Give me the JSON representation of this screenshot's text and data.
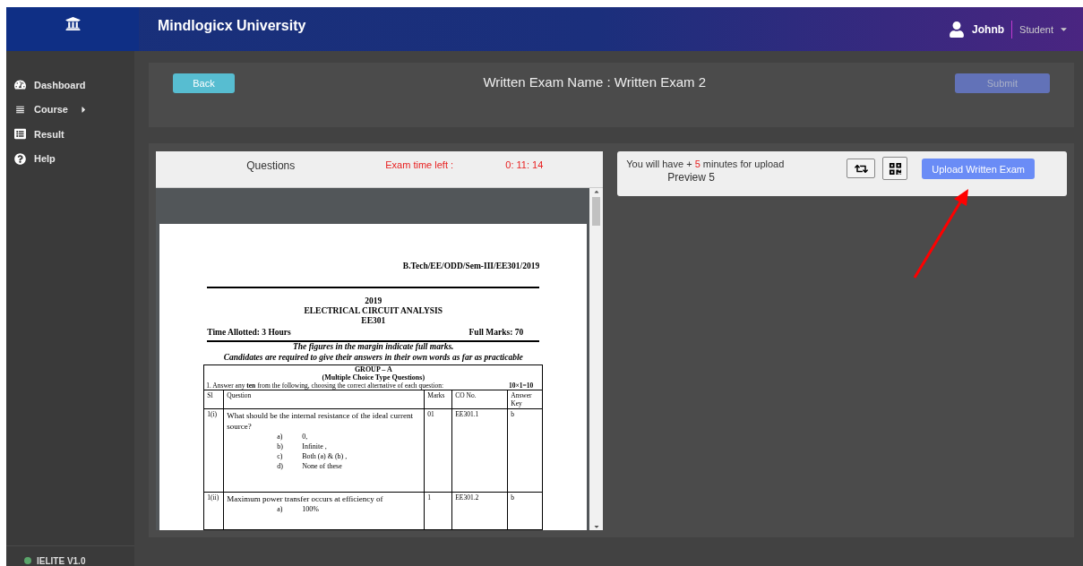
{
  "header": {
    "title": "Mindlogicx University",
    "user": {
      "name": "Johnb",
      "role": "Student"
    }
  },
  "sidebar": {
    "items": [
      {
        "kind": "dashboard",
        "label": "Dashboard",
        "submenu": false
      },
      {
        "kind": "course",
        "label": "Course",
        "submenu": true
      },
      {
        "kind": "result",
        "label": "Result",
        "submenu": false
      },
      {
        "kind": "help",
        "label": "Help",
        "submenu": false
      }
    ],
    "version": "IELITE V1.0"
  },
  "exam_bar": {
    "back": "Back",
    "title": "Written Exam Name : Written Exam 2",
    "submit": {
      "label": "Submit",
      "disabled": true
    }
  },
  "questions_panel": {
    "title": "Questions",
    "timer_label": "Exam time left :",
    "timer_value": "0: 11: 14"
  },
  "document": {
    "ref": "B.Tech/EE/ODD/Sem-III/EE301/2019",
    "year": "2019",
    "subject": "ELECTRICAL CIRCUIT ANALYSIS",
    "code": "EE301",
    "time_allotted": "Time Allotted: 3 Hours",
    "full_marks": "Full Marks: 70",
    "instructions": [
      "The figures in the margin indicate full marks.",
      "Candidates are required to give their answers in their own words as far as practicable"
    ],
    "group": "GROUP – A",
    "group_subtitle": "(Multiple Choice Type Questions)",
    "directive": "1. Answer any **ten** from the following, choosing the correct alternative of each question:",
    "directive_marks": "10×1=10",
    "columns": [
      "Sl",
      "Question",
      "Marks",
      "CO No.",
      "Answer Key"
    ],
    "rows": [
      {
        "sl": "1(i)",
        "question": "What should be the internal resistance of the ideal current source?",
        "options": [
          {
            "letter": "a)",
            "text": "0,"
          },
          {
            "letter": "b)",
            "text": "Infinite ,"
          },
          {
            "letter": "c)",
            "text": "Both (a) & (b) ,"
          },
          {
            "letter": "d)",
            "text": "None of these"
          }
        ],
        "marks": "01",
        "co": "EE301.1",
        "key": "b"
      },
      {
        "sl": "1(ii)",
        "question": "Maximum power transfer occurs at efficiency of",
        "options": [
          {
            "letter": "a)",
            "text": "100%"
          }
        ],
        "marks": "1",
        "co": "EE301.2",
        "key": "b"
      }
    ]
  },
  "upload_panel": {
    "note_prefix": "You will have +",
    "note_minutes": "5",
    "note_suffix": "minutes for upload",
    "preview": "Preview 5",
    "upload": "Upload Written Exam"
  }
}
